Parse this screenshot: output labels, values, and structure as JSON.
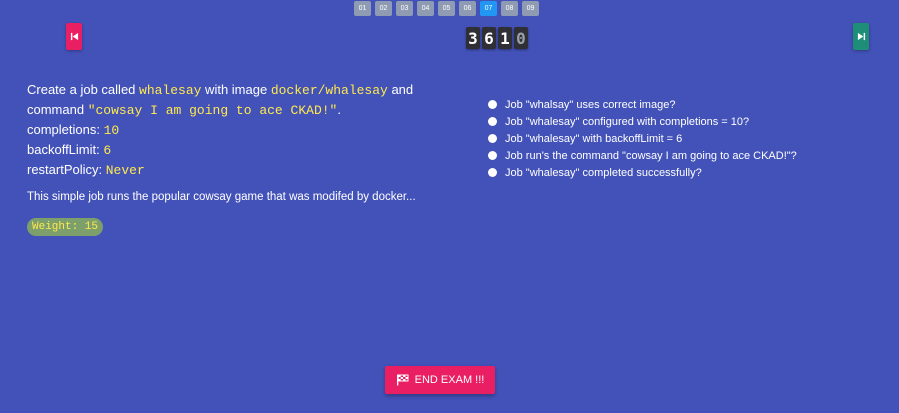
{
  "nav": {
    "questions": [
      "01",
      "02",
      "03",
      "04",
      "05",
      "06",
      "07",
      "08",
      "09"
    ],
    "active_index": 6
  },
  "timer": {
    "digits": [
      "3",
      "6",
      "1",
      "0"
    ]
  },
  "question": {
    "line1_prefix": "Create a job called ",
    "job_name": "whalesay",
    "line1_mid": " with image ",
    "image": "docker/whalesay",
    "line1_suffix": " and",
    "line2_prefix": "command ",
    "command": "\"cowsay I am going to ace CKAD!\"",
    "line2_suffix": ".",
    "completions_label": "completions: ",
    "completions_value": "10",
    "backoff_label": "backoffLimit: ",
    "backoff_value": "6",
    "restart_label": "restartPolicy: ",
    "restart_value": "Never"
  },
  "description": "This simple job runs the popular cowsay game that was modifed by docker...",
  "weight": "Weight: 15",
  "checks": [
    "Job \"whalsay\" uses correct image?",
    "Job \"whalesay\" configured with completions = 10?",
    "Job \"whalesay\" with backoffLimit = 6",
    "Job run's the command \"cowsay I am going to ace CKAD!\"?",
    "Job \"whalesay\" completed successfully?"
  ],
  "end_button": "END EXAM !!!",
  "icons": {
    "prev": "skip-previous-icon",
    "next": "skip-next-icon",
    "flag": "flag-icon"
  },
  "colors": {
    "background": "#4352b8",
    "accent_pink": "#e91e63",
    "accent_teal": "#1e8e78",
    "active_question": "#2196f3",
    "code_yellow": "#ffe94d"
  }
}
